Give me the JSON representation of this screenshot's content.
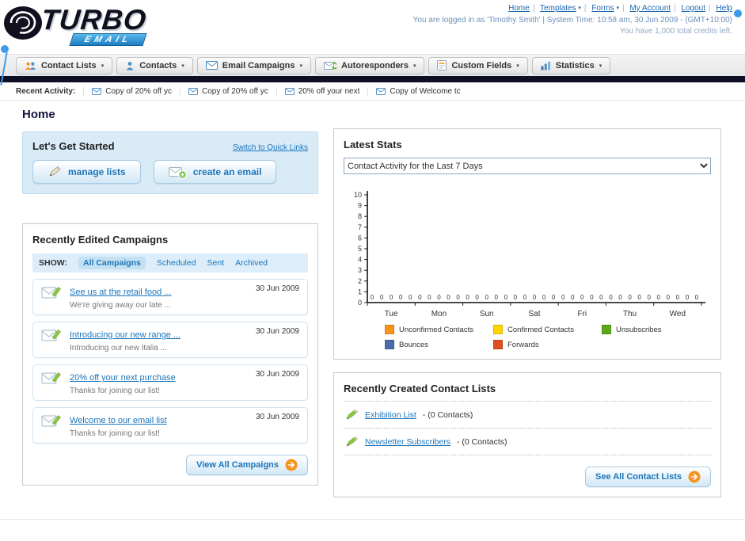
{
  "ui": {
    "caret": "▾",
    "separator": "|"
  },
  "header": {
    "logo_text": "TURBO",
    "logo_sub": "EMAIL",
    "nav_links": [
      "Home",
      "Templates",
      "Forms",
      "My Account",
      "Logout",
      "Help"
    ],
    "login_info": "You are logged in as 'Timothy Smith' | System Time: 10:58 am, 30 Jun 2009 - (GMT+10:00)",
    "credits_info": "You have 1,000 total credits left."
  },
  "nav_tabs": [
    {
      "label": "Contact Lists"
    },
    {
      "label": "Contacts"
    },
    {
      "label": "Email Campaigns"
    },
    {
      "label": "Autoresponders"
    },
    {
      "label": "Custom Fields"
    },
    {
      "label": "Statistics"
    }
  ],
  "recent_activity": {
    "label": "Recent Activity:",
    "items": [
      "Copy of 20% off yc",
      "Copy of 20% off yc",
      "20% off your next",
      "Copy of Welcome tc"
    ]
  },
  "page_title": "Home",
  "get_started": {
    "title": "Let's Get Started",
    "switch_link": "Switch to Quick Links",
    "manage_lists": "manage lists",
    "create_email": "create an email"
  },
  "campaigns": {
    "title": "Recently Edited Campaigns",
    "show_label": "SHOW:",
    "tabs": [
      "All Campaigns",
      "Scheduled",
      "Sent",
      "Archived"
    ],
    "active_tab": "All Campaigns",
    "items": [
      {
        "title": "See us at the retail food ...",
        "subtitle": "We're giving away our late ...",
        "date": "30 Jun 2009"
      },
      {
        "title": "Introducing our new range ...",
        "subtitle": "Introducing our new Italia ...",
        "date": "30 Jun 2009"
      },
      {
        "title": "20% off your next purchase",
        "subtitle": "Thanks for joining our list!",
        "date": "30 Jun 2009"
      },
      {
        "title": "Welcome to our email list",
        "subtitle": "Thanks for joining our list!",
        "date": "30 Jun 2009"
      }
    ],
    "view_all": "View All Campaigns"
  },
  "stats": {
    "title": "Latest Stats",
    "dropdown_value": "Contact Activity for the Last 7 Days"
  },
  "chart_data": {
    "type": "bar",
    "categories": [
      "Tue",
      "Mon",
      "Sun",
      "Sat",
      "Fri",
      "Thu",
      "Wed"
    ],
    "series": [
      {
        "name": "Unconfirmed Contacts",
        "color": "#f7941d",
        "values": [
          0,
          0,
          0,
          0,
          0,
          0,
          0
        ]
      },
      {
        "name": "Confirmed Contacts",
        "color": "#ffd400",
        "values": [
          0,
          0,
          0,
          0,
          0,
          0,
          0
        ]
      },
      {
        "name": "Unsubscribes",
        "color": "#5ba818",
        "values": [
          0,
          0,
          0,
          0,
          0,
          0,
          0
        ]
      },
      {
        "name": "Bounces",
        "color": "#4a6da7",
        "values": [
          0,
          0,
          0,
          0,
          0,
          0,
          0
        ]
      },
      {
        "name": "Forwards",
        "color": "#e04f1f",
        "values": [
          0,
          0,
          0,
          0,
          0,
          0,
          0
        ]
      }
    ],
    "title": "Contact Activity for the Last 7 Days",
    "xlabel": "",
    "ylabel": "",
    "ylim": [
      0,
      10
    ],
    "yticks": [
      0,
      1,
      2,
      3,
      4,
      5,
      6,
      7,
      8,
      9,
      10
    ],
    "show_value_labels": true,
    "legend_position": "bottom",
    "grid": false
  },
  "contact_lists": {
    "title": "Recently Created Contact Lists",
    "items": [
      {
        "name": "Exhibition List",
        "suffix": "- (0 Contacts)"
      },
      {
        "name": "Newsletter Subscribers",
        "suffix": "- (0 Contacts)"
      }
    ],
    "see_all": "See All Contact Lists"
  }
}
